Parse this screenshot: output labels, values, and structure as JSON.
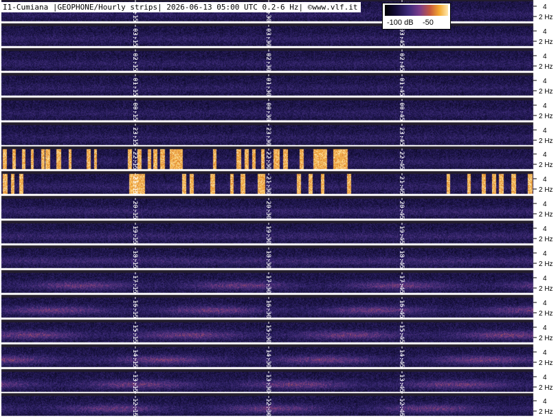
{
  "title": "I1-Cumiana |GEOPHONE/Hourly strips| 2026-06-13 05:00 UTC 0.2-6 Hz| ©www.vlf.it",
  "legend": {
    "min_label": "-100 dB",
    "max_label": "-50"
  },
  "chart_data": {
    "type": "heatmap",
    "title": "I1-Cumiana |GEOPHONE/Hourly strips| 2026-06-13 05:00 UTC 0.2-6 Hz| ©www.vlf.it",
    "colorbar": {
      "min": -100,
      "max": -50,
      "unit": "dB",
      "tick_labels": [
        "-100 dB",
        "-50"
      ]
    },
    "frequency_axis": {
      "tick_labels": [
        "4",
        "2 Hz"
      ],
      "ticks": [
        4,
        2
      ]
    },
    "strips": [
      {
        "labels": [
          "04:15",
          "04:30"
        ],
        "intensity": 0.3,
        "bursts": []
      },
      {
        "labels": [
          "03:15",
          "03:30",
          "03:45"
        ],
        "intensity": 0.32,
        "bursts": []
      },
      {
        "labels": [
          "02:15",
          "02:30",
          "02:45"
        ],
        "intensity": 0.3,
        "bursts": []
      },
      {
        "labels": [
          "01:15",
          "01:30",
          "01:45"
        ],
        "intensity": 0.28,
        "bursts": []
      },
      {
        "labels": [
          "00:15",
          "00:30",
          "00:45"
        ],
        "intensity": 0.27,
        "bursts": []
      },
      {
        "labels": [
          "23:15",
          "23:30",
          "23:45"
        ],
        "intensity": 0.28,
        "bursts": []
      },
      {
        "labels": [
          "22:15",
          "22:30",
          "22:45"
        ],
        "intensity": 0.3,
        "bursts": [
          [
            4,
            9
          ],
          [
            18,
            22
          ],
          [
            32,
            36
          ],
          [
            45,
            48
          ],
          [
            60,
            64
          ],
          [
            66,
            72
          ],
          [
            82,
            88
          ],
          [
            100,
            103
          ],
          [
            126,
            131
          ],
          [
            137,
            140
          ],
          [
            186,
            191
          ],
          [
            200,
            205
          ],
          [
            215,
            219
          ],
          [
            223,
            228
          ],
          [
            233,
            239
          ],
          [
            247,
            265
          ],
          [
            310,
            314
          ],
          [
            344,
            350
          ],
          [
            356,
            361
          ],
          [
            367,
            371
          ],
          [
            380,
            384
          ],
          [
            398,
            406
          ],
          [
            412,
            418
          ],
          [
            436,
            441
          ],
          [
            456,
            475
          ],
          [
            485,
            505
          ]
        ]
      },
      {
        "labels": [
          "21:15",
          "21:30",
          "21:45"
        ],
        "intensity": 0.34,
        "bursts": [
          [
            4,
            10
          ],
          [
            16,
            20
          ],
          [
            28,
            33
          ],
          [
            188,
            210
          ],
          [
            265,
            270
          ],
          [
            276,
            281
          ],
          [
            306,
            312
          ],
          [
            335,
            339
          ],
          [
            350,
            356
          ],
          [
            375,
            385
          ],
          [
            432,
            437
          ],
          [
            449,
            454
          ],
          [
            467,
            471
          ],
          [
            505,
            510
          ],
          [
            650,
            654
          ],
          [
            680,
            684
          ],
          [
            701,
            706
          ],
          [
            716,
            721
          ],
          [
            726,
            732
          ],
          [
            744,
            750
          ],
          [
            768,
            774
          ]
        ]
      },
      {
        "labels": [
          "20:15",
          "20:30",
          "20:45"
        ],
        "intensity": 0.4,
        "bursts": []
      },
      {
        "labels": [
          "19:15",
          "19:30",
          "19:45"
        ],
        "intensity": 0.42,
        "bursts": []
      },
      {
        "labels": [
          "18:15",
          "18:30",
          "18:45"
        ],
        "intensity": 0.5,
        "bursts": []
      },
      {
        "labels": [
          "17:15",
          "17:30",
          "17:45"
        ],
        "intensity": 0.62,
        "bursts": []
      },
      {
        "labels": [
          "16:15",
          "16:30",
          "16:45"
        ],
        "intensity": 0.64,
        "bursts": []
      },
      {
        "labels": [
          "15:15",
          "15:30",
          "15:45"
        ],
        "intensity": 0.66,
        "bursts": []
      },
      {
        "labels": [
          "14:15",
          "14:30",
          "14:45"
        ],
        "intensity": 0.65,
        "bursts": []
      },
      {
        "labels": [
          "13:15",
          "13:30",
          "13:45"
        ],
        "intensity": 0.66,
        "bursts": []
      },
      {
        "labels": [
          "12:15",
          "12:30",
          "12:45"
        ],
        "intensity": 0.6,
        "bursts": []
      }
    ]
  }
}
